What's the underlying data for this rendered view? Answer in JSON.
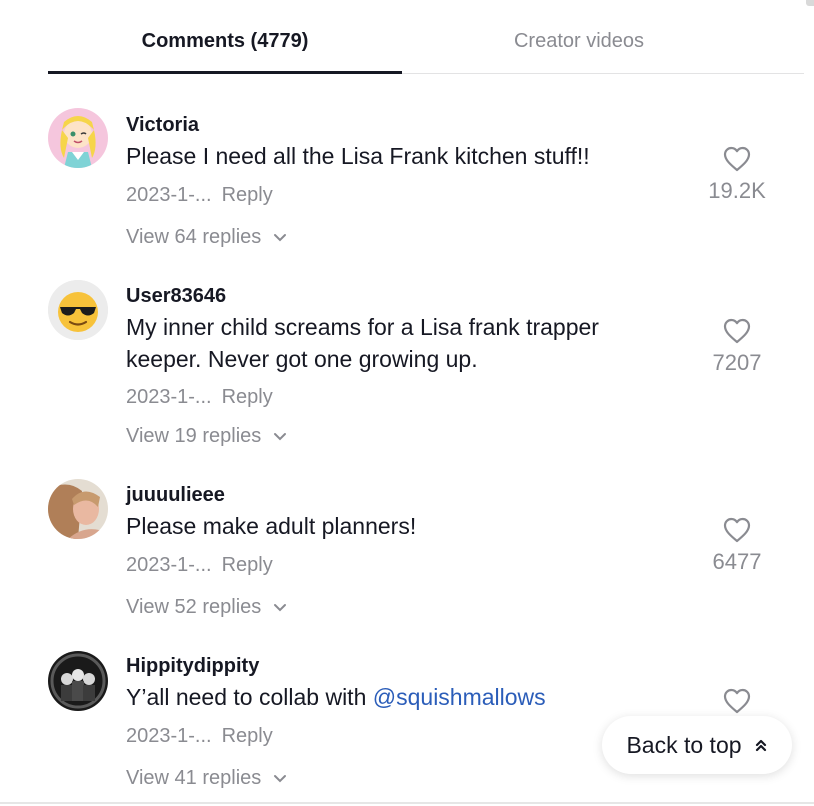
{
  "tabs": {
    "comments_label": "Comments (4779)",
    "creator_label": "Creator videos"
  },
  "comments": [
    {
      "username": "Victoria",
      "text": "Please I need all the Lisa Frank kitchen stuff!!",
      "date": "2023-1-...",
      "reply_label": "Reply",
      "likes": "19.2K",
      "view_replies": "View 64 replies"
    },
    {
      "username": "User83646",
      "text": "My inner child screams for a Lisa frank trapper keeper. Never got one growing up.",
      "date": "2023-1-...",
      "reply_label": "Reply",
      "likes": "7207",
      "view_replies": "View 19 replies"
    },
    {
      "username": "juuuulieee",
      "text": "Please make adult planners!",
      "date": "2023-1-...",
      "reply_label": "Reply",
      "likes": "6477",
      "view_replies": "View 52 replies"
    },
    {
      "username": "Hippitydippity",
      "text_prefix": "Y’all need to collab with ",
      "mention": "@squishmallows",
      "date": "2023-1-...",
      "reply_label": "Reply",
      "view_replies": "View 41 replies"
    }
  ],
  "back_to_top": "Back to top",
  "colors": {
    "text_primary": "#161823",
    "text_secondary": "#8a8b91",
    "mention": "#2b5db9",
    "divider": "#e3e3e4"
  },
  "icons": {
    "like": "heart-outline-icon",
    "expand": "chevron-down-icon",
    "back_to_top": "double-chevron-up-icon"
  }
}
